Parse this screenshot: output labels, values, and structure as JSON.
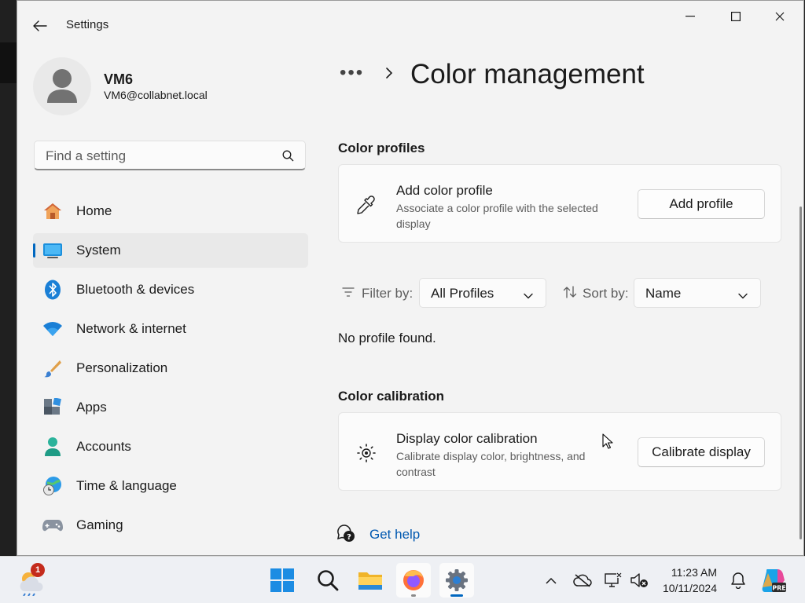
{
  "window": {
    "app_title": "Settings",
    "minimize_label": "—",
    "maximize_label": "☐",
    "close_label": "✕"
  },
  "user": {
    "name": "VM6",
    "email": "VM6@collabnet.local"
  },
  "search": {
    "placeholder": "Find a setting",
    "value": ""
  },
  "sidebar": {
    "items": [
      {
        "label": "Home",
        "icon": "home-icon",
        "active": false
      },
      {
        "label": "System",
        "icon": "system-icon",
        "active": true
      },
      {
        "label": "Bluetooth & devices",
        "icon": "bluetooth-icon",
        "active": false
      },
      {
        "label": "Network & internet",
        "icon": "wifi-icon",
        "active": false
      },
      {
        "label": "Personalization",
        "icon": "brush-icon",
        "active": false
      },
      {
        "label": "Apps",
        "icon": "apps-icon",
        "active": false
      },
      {
        "label": "Accounts",
        "icon": "accounts-icon",
        "active": false
      },
      {
        "label": "Time & language",
        "icon": "globe-clock-icon",
        "active": false
      },
      {
        "label": "Gaming",
        "icon": "gamepad-icon",
        "active": false
      }
    ]
  },
  "breadcrumb": {
    "overflow": "•••",
    "current": "Color management"
  },
  "color_profiles": {
    "section_title": "Color profiles",
    "card_title": "Add color profile",
    "card_desc": "Associate a color profile with the selected display",
    "button": "Add profile",
    "icon": "eyedropper-icon"
  },
  "filter": {
    "filter_label": "Filter by:",
    "filter_value": "All Profiles",
    "sort_label": "Sort by:",
    "sort_value": "Name"
  },
  "empty_message": "No profile found.",
  "color_calibration": {
    "section_title": "Color calibration",
    "card_title": "Display color calibration",
    "card_desc": "Calibrate display color, brightness, and contrast",
    "button": "Calibrate display",
    "icon": "brightness-icon"
  },
  "help": {
    "label": "Get help"
  },
  "taskbar": {
    "weather_badge": "1",
    "pinned": [
      "start-icon",
      "search-icon",
      "file-explorer-icon",
      "firefox-icon",
      "settings-icon"
    ],
    "time": "11:23 AM",
    "date": "10/11/2024",
    "copilot_badge": "PRE"
  },
  "colors": {
    "accent": "#0067c0",
    "link": "#0058b0",
    "window_bg": "#f3f3f3",
    "card_bg": "#fbfbfb",
    "badge_red": "#c42b1c"
  }
}
